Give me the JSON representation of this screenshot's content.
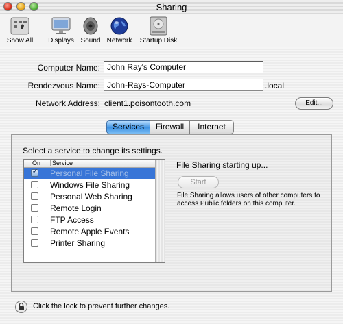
{
  "window": {
    "title": "Sharing"
  },
  "toolbar": {
    "items": [
      {
        "label": "Show All",
        "icon": "show-all-icon"
      },
      {
        "label": "Displays",
        "icon": "displays-icon"
      },
      {
        "label": "Sound",
        "icon": "speaker-icon"
      },
      {
        "label": "Network",
        "icon": "globe-icon"
      },
      {
        "label": "Startup Disk",
        "icon": "hard-disk-icon"
      }
    ]
  },
  "identity": {
    "computer_name_label": "Computer Name:",
    "computer_name_value": "John Ray's Computer",
    "rendezvous_label": "Rendezvous Name:",
    "rendezvous_value": "John-Rays-Computer",
    "rendezvous_suffix": ".local",
    "network_label": "Network Address:",
    "network_value": "client1.poisontooth.com",
    "edit_label": "Edit..."
  },
  "tabs": [
    {
      "label": "Services",
      "selected": true
    },
    {
      "label": "Firewall",
      "selected": false
    },
    {
      "label": "Internet",
      "selected": false
    }
  ],
  "services": {
    "instruction": "Select a service to change its settings.",
    "col_on": "On",
    "col_service": "Service",
    "items": [
      {
        "label": "Personal File Sharing",
        "checked": true,
        "selected": true
      },
      {
        "label": "Windows File Sharing",
        "checked": false,
        "selected": false
      },
      {
        "label": "Personal Web Sharing",
        "checked": false,
        "selected": false
      },
      {
        "label": "Remote Login",
        "checked": false,
        "selected": false
      },
      {
        "label": "FTP Access",
        "checked": false,
        "selected": false
      },
      {
        "label": "Remote Apple Events",
        "checked": false,
        "selected": false
      },
      {
        "label": "Printer Sharing",
        "checked": false,
        "selected": false
      }
    ],
    "status": "File Sharing starting up...",
    "start_label": "Start",
    "description": "File Sharing allows users of other computers to access Public folders on this computer."
  },
  "footer": {
    "lock_text": "Click the lock to prevent further changes.",
    "lock_icon": "lock-icon"
  },
  "colors": {
    "selection": "#3875d7",
    "tab_selected": "#3f93e3"
  }
}
